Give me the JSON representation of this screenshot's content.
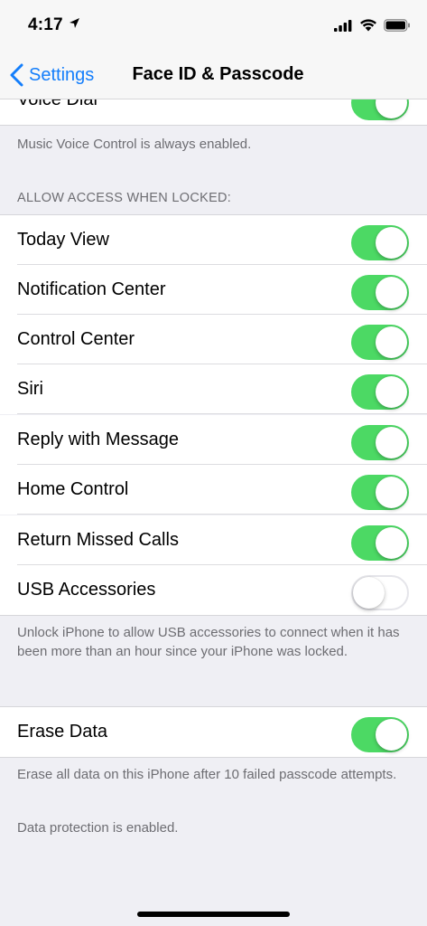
{
  "status_bar": {
    "time": "4:17"
  },
  "nav": {
    "back_label": "Settings",
    "title": "Face ID & Passcode"
  },
  "top_row": {
    "label": "Voice Dial",
    "on": true
  },
  "voice_footer": "Music Voice Control is always enabled.",
  "locked_section": {
    "header": "ALLOW ACCESS WHEN LOCKED:",
    "items": [
      {
        "label": "Today View",
        "on": true
      },
      {
        "label": "Notification Center",
        "on": true
      },
      {
        "label": "Control Center",
        "on": true
      },
      {
        "label": "Siri",
        "on": true
      },
      {
        "label": "Reply with Message",
        "on": true
      },
      {
        "label": "Home Control",
        "on": true
      },
      {
        "label": "Return Missed Calls",
        "on": true
      },
      {
        "label": "USB Accessories",
        "on": false
      }
    ],
    "footer": "Unlock iPhone to allow USB accessories to connect when it has been more than an hour since your iPhone was locked."
  },
  "erase_section": {
    "label": "Erase Data",
    "on": true,
    "footer": "Erase all data on this iPhone after 10 failed passcode attempts.",
    "status": "Data protection is enabled."
  },
  "colors": {
    "accent": "#147efb",
    "toggle_on": "#4cd964",
    "background": "#efeff4"
  }
}
